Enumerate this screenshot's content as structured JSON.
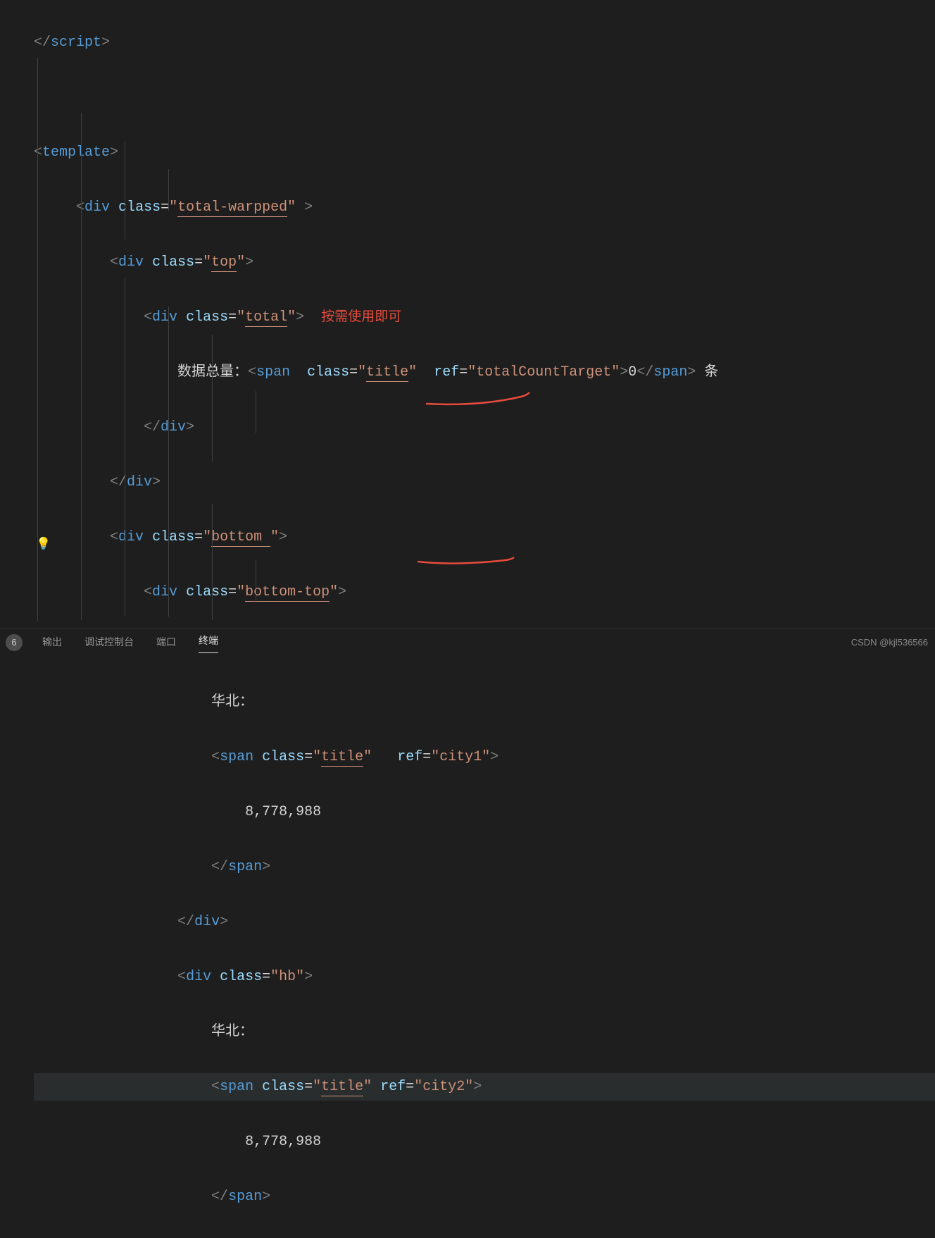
{
  "code": {
    "tags": {
      "script": "script",
      "template": "template",
      "div": "div",
      "span": "span"
    },
    "attrs": {
      "class": "class",
      "ref": "ref"
    },
    "classValues": {
      "totalWarpped": "total-warpped",
      "top": "top",
      "total": "total",
      "title": "title",
      "bottom": "bottom ",
      "bottomTop": "bottom-top",
      "hb": "hb"
    },
    "refValues": {
      "totalCountTarget": "totalCountTarget",
      "city1": "city1",
      "city2": "city2"
    },
    "textContent": {
      "dataTotal": "数据总量：",
      "zero": "0",
      "tiao": " 条",
      "huabei": "华北：",
      "number1": "8,778,988",
      "number2": "8,778,988"
    }
  },
  "annotation": {
    "comment": "按需使用即可"
  },
  "bottomBar": {
    "count": "6",
    "tabs": {
      "output": "输出",
      "debugConsole": "调试控制台",
      "port": "端口",
      "terminal": "终端"
    }
  },
  "watermark": "CSDN @kjl536566"
}
